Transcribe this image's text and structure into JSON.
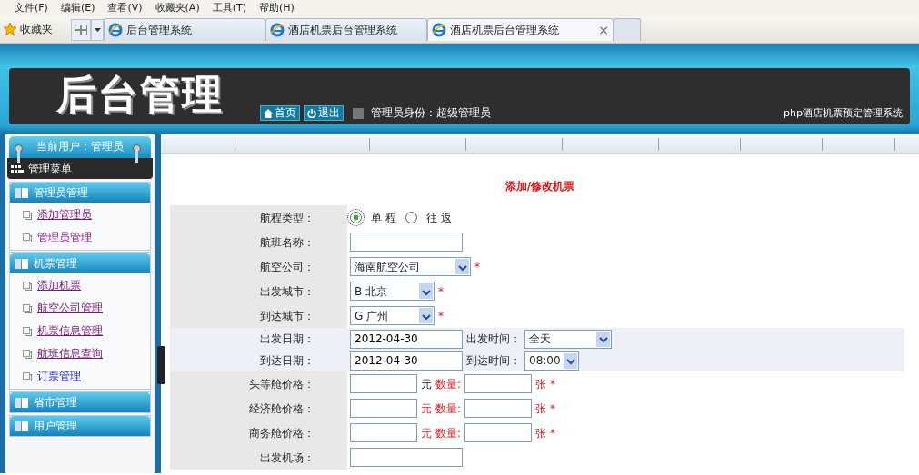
{
  "menu_bar": {
    "items": [
      "文件(F)",
      "编辑(E)",
      "查看(V)",
      "收藏夹(A)",
      "工具(T)",
      "帮助(H)"
    ]
  },
  "tab_bar": {
    "favorites": "收藏夹",
    "tabs": [
      {
        "label": "后台管理系统",
        "selected": false
      },
      {
        "label": "酒店机票后台管理系统",
        "selected": false
      },
      {
        "label": "酒店机票后台管理系统",
        "selected": true
      }
    ],
    "close": "×"
  },
  "header": {
    "logo": "后台管理",
    "home_button": "首页",
    "logout_button": "退出",
    "identity": "管理员身份：超级管理员",
    "system_name": "php酒店机票预定管理系统"
  },
  "sidebar": {
    "current_user": "当前用户：管理员",
    "menu_title": "管理菜单",
    "groups": [
      {
        "title": "管理员管理",
        "children": [
          {
            "label": "添加管理员",
            "visited": true
          },
          {
            "label": "管理员管理",
            "visited": true
          }
        ]
      },
      {
        "title": "机票管理",
        "children": [
          {
            "label": "添加机票",
            "visited": true
          },
          {
            "label": "航空公司管理",
            "visited": true
          },
          {
            "label": "机票信息管理",
            "visited": true
          },
          {
            "label": "航班信息查询",
            "visited": true
          },
          {
            "label": "订票管理",
            "visited": false
          }
        ]
      },
      {
        "title": "省市管理"
      },
      {
        "title": "用户管理"
      }
    ]
  },
  "form": {
    "title": "添加/修改机票",
    "rows": [
      {
        "kind": "radio",
        "label": "航程类型：",
        "options": [
          {
            "label": "单 程",
            "selected": true
          },
          {
            "label": "往 返",
            "selected": false
          }
        ]
      },
      {
        "kind": "text",
        "label": "航班名称："
      },
      {
        "kind": "select",
        "label": "航空公司：",
        "value": "海南航空公司",
        "required": "*"
      },
      {
        "kind": "select",
        "label": "出发城市：",
        "value": "B 北京",
        "required": "*"
      },
      {
        "kind": "select",
        "label": "到达城市：",
        "value": "G 广州",
        "required": "*"
      },
      {
        "kind": "datetime",
        "label": "出发日期：",
        "value": "2012-04-30",
        "time_label": "出发时间：",
        "time_value": "全天"
      },
      {
        "kind": "datetime",
        "label": "到达日期：",
        "value": "2012-04-30",
        "time_label": "到达时间：",
        "time_value": "08:00"
      },
      {
        "kind": "price",
        "label": "头等舱价格：",
        "unit": "元",
        "unit_highlighted": false,
        "qty_label": "数量:",
        "qty_unit": "张",
        "required": "*"
      },
      {
        "kind": "price",
        "label": "经济舱价格：",
        "unit": "元",
        "unit_highlighted": true,
        "qty_label": "数量:",
        "qty_unit": "张",
        "required": "*"
      },
      {
        "kind": "price",
        "label": "商务舱价格：",
        "unit": "元",
        "unit_highlighted": true,
        "qty_label": "数量:",
        "qty_unit": "张",
        "required": "*"
      },
      {
        "kind": "text",
        "label": "出发机场："
      }
    ]
  }
}
